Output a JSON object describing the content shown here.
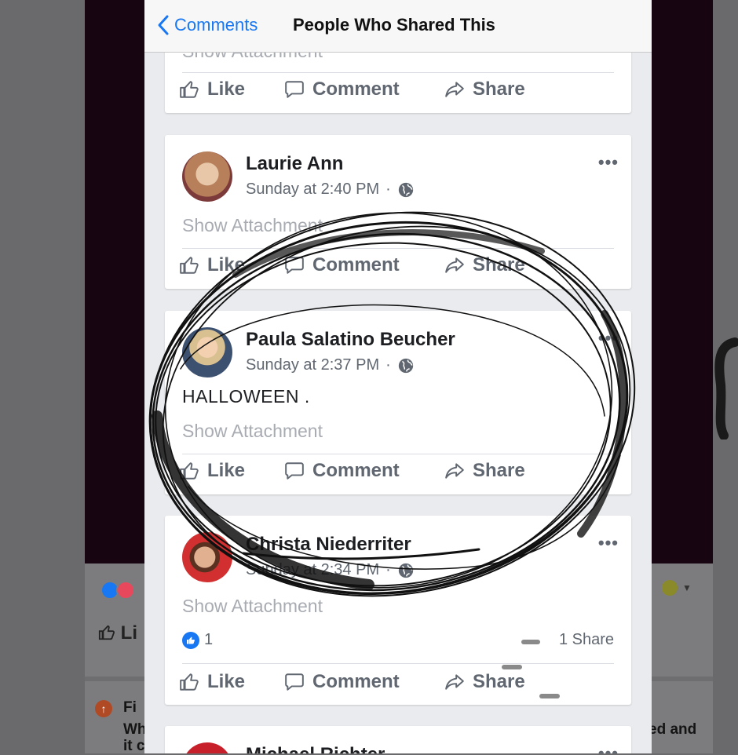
{
  "navbar": {
    "back_label": "Comments",
    "title": "People Who Shared This"
  },
  "actions": {
    "like": "Like",
    "comment": "Comment",
    "share": "Share"
  },
  "top_card": {
    "attachment": "Show Attachment"
  },
  "posts": [
    {
      "name": "Laurie Ann",
      "time": "Sunday at 2:40 PM",
      "attachment": "Show Attachment",
      "avatar_color": "#c28a6e"
    },
    {
      "name": "Paula Salatino Beucher",
      "time": "Sunday at 2:37 PM",
      "text": "HALLOWEEN .",
      "attachment": "Show Attachment",
      "avatar_color": "#6b7f95"
    },
    {
      "name": "Christa Niederriter",
      "time": "Sunday at 2:34 PM",
      "attachment": "Show Attachment",
      "like_count": "1",
      "share_count": "1 Share",
      "avatar_color": "#c23a3a"
    },
    {
      "name": "Michael Richter"
    }
  ],
  "background": {
    "like_label": "Li",
    "fi_text": "Fi",
    "wh_text": "Wh",
    "it_text": "it c",
    "right_text": "ed and"
  },
  "icons": [
    "chevron-left-icon",
    "thumbs-up-icon",
    "comment-icon",
    "share-arrow-icon",
    "globe-icon",
    "more-options-icon"
  ],
  "colors": {
    "accent": "#1877f2",
    "text": "#1c1e21",
    "muted": "#606770",
    "attachment": "#a8acb2"
  }
}
